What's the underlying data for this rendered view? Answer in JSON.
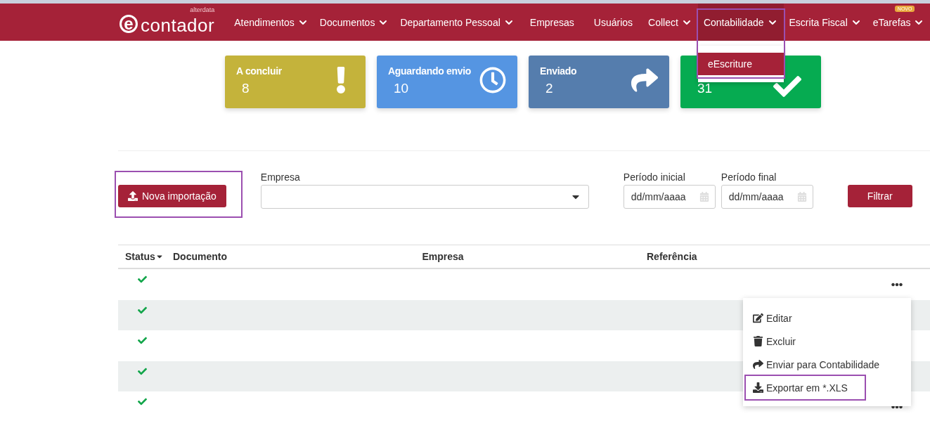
{
  "logo": {
    "mark": "e",
    "name": "contador",
    "brand": "alterdata"
  },
  "nav": {
    "items": [
      {
        "label": "Atendimentos",
        "dropdown": true,
        "selected": false,
        "highlighted": false
      },
      {
        "label": "Documentos",
        "dropdown": true,
        "selected": false,
        "highlighted": false
      },
      {
        "label": "Departamento Pessoal",
        "dropdown": true,
        "selected": false,
        "highlighted": false
      },
      {
        "label": "Empresas",
        "dropdown": false,
        "selected": false,
        "highlighted": false
      },
      {
        "label": "Usuários",
        "dropdown": false,
        "selected": false,
        "highlighted": false
      },
      {
        "label": "Collect",
        "dropdown": true,
        "selected": false,
        "highlighted": false
      },
      {
        "label": "Contabilidade",
        "dropdown": true,
        "selected": true,
        "highlighted": true,
        "menu": [
          "eEscriture"
        ]
      },
      {
        "label": "Escrita Fiscal",
        "dropdown": true,
        "selected": false,
        "highlighted": false
      },
      {
        "label": "eTarefas",
        "dropdown": true,
        "selected": false,
        "highlighted": false,
        "badge": "NOVO"
      }
    ]
  },
  "cards": [
    {
      "kind": "pending",
      "title": "A concluir",
      "value": "8",
      "color": "#c4b33b"
    },
    {
      "kind": "waiting",
      "title": "Aguardando envio",
      "value": "10",
      "color": "#5595e2"
    },
    {
      "kind": "sent",
      "title": "Enviado",
      "value": "2",
      "color": "#557dad"
    },
    {
      "kind": "done",
      "value": "31",
      "color": "#06ab51"
    }
  ],
  "filters": {
    "import_button": {
      "label": "Nova importação",
      "highlighted": true
    },
    "company": {
      "label": "Empresa"
    },
    "start": {
      "label": "Período inicial",
      "placeholder": "dd/mm/aaaa"
    },
    "end": {
      "label": "Período final",
      "placeholder": "dd/mm/aaaa"
    },
    "filter_button": "Filtrar"
  },
  "table": {
    "columns": [
      "Status",
      "Documento",
      "Empresa",
      "Referência"
    ],
    "rows": [
      {
        "kind": "done"
      },
      {
        "kind": "done"
      },
      {
        "kind": "done"
      },
      {
        "kind": "done"
      },
      {
        "kind": "done"
      }
    ]
  },
  "row_menu": {
    "items": [
      {
        "kind": "edit",
        "label": "Editar",
        "highlighted": false
      },
      {
        "kind": "delete",
        "label": "Excluir",
        "highlighted": false
      },
      {
        "kind": "send",
        "label": "Enviar para Contabilidade",
        "highlighted": false
      },
      {
        "kind": "export",
        "label": "Exportar em *.XLS",
        "highlighted": true
      }
    ]
  }
}
